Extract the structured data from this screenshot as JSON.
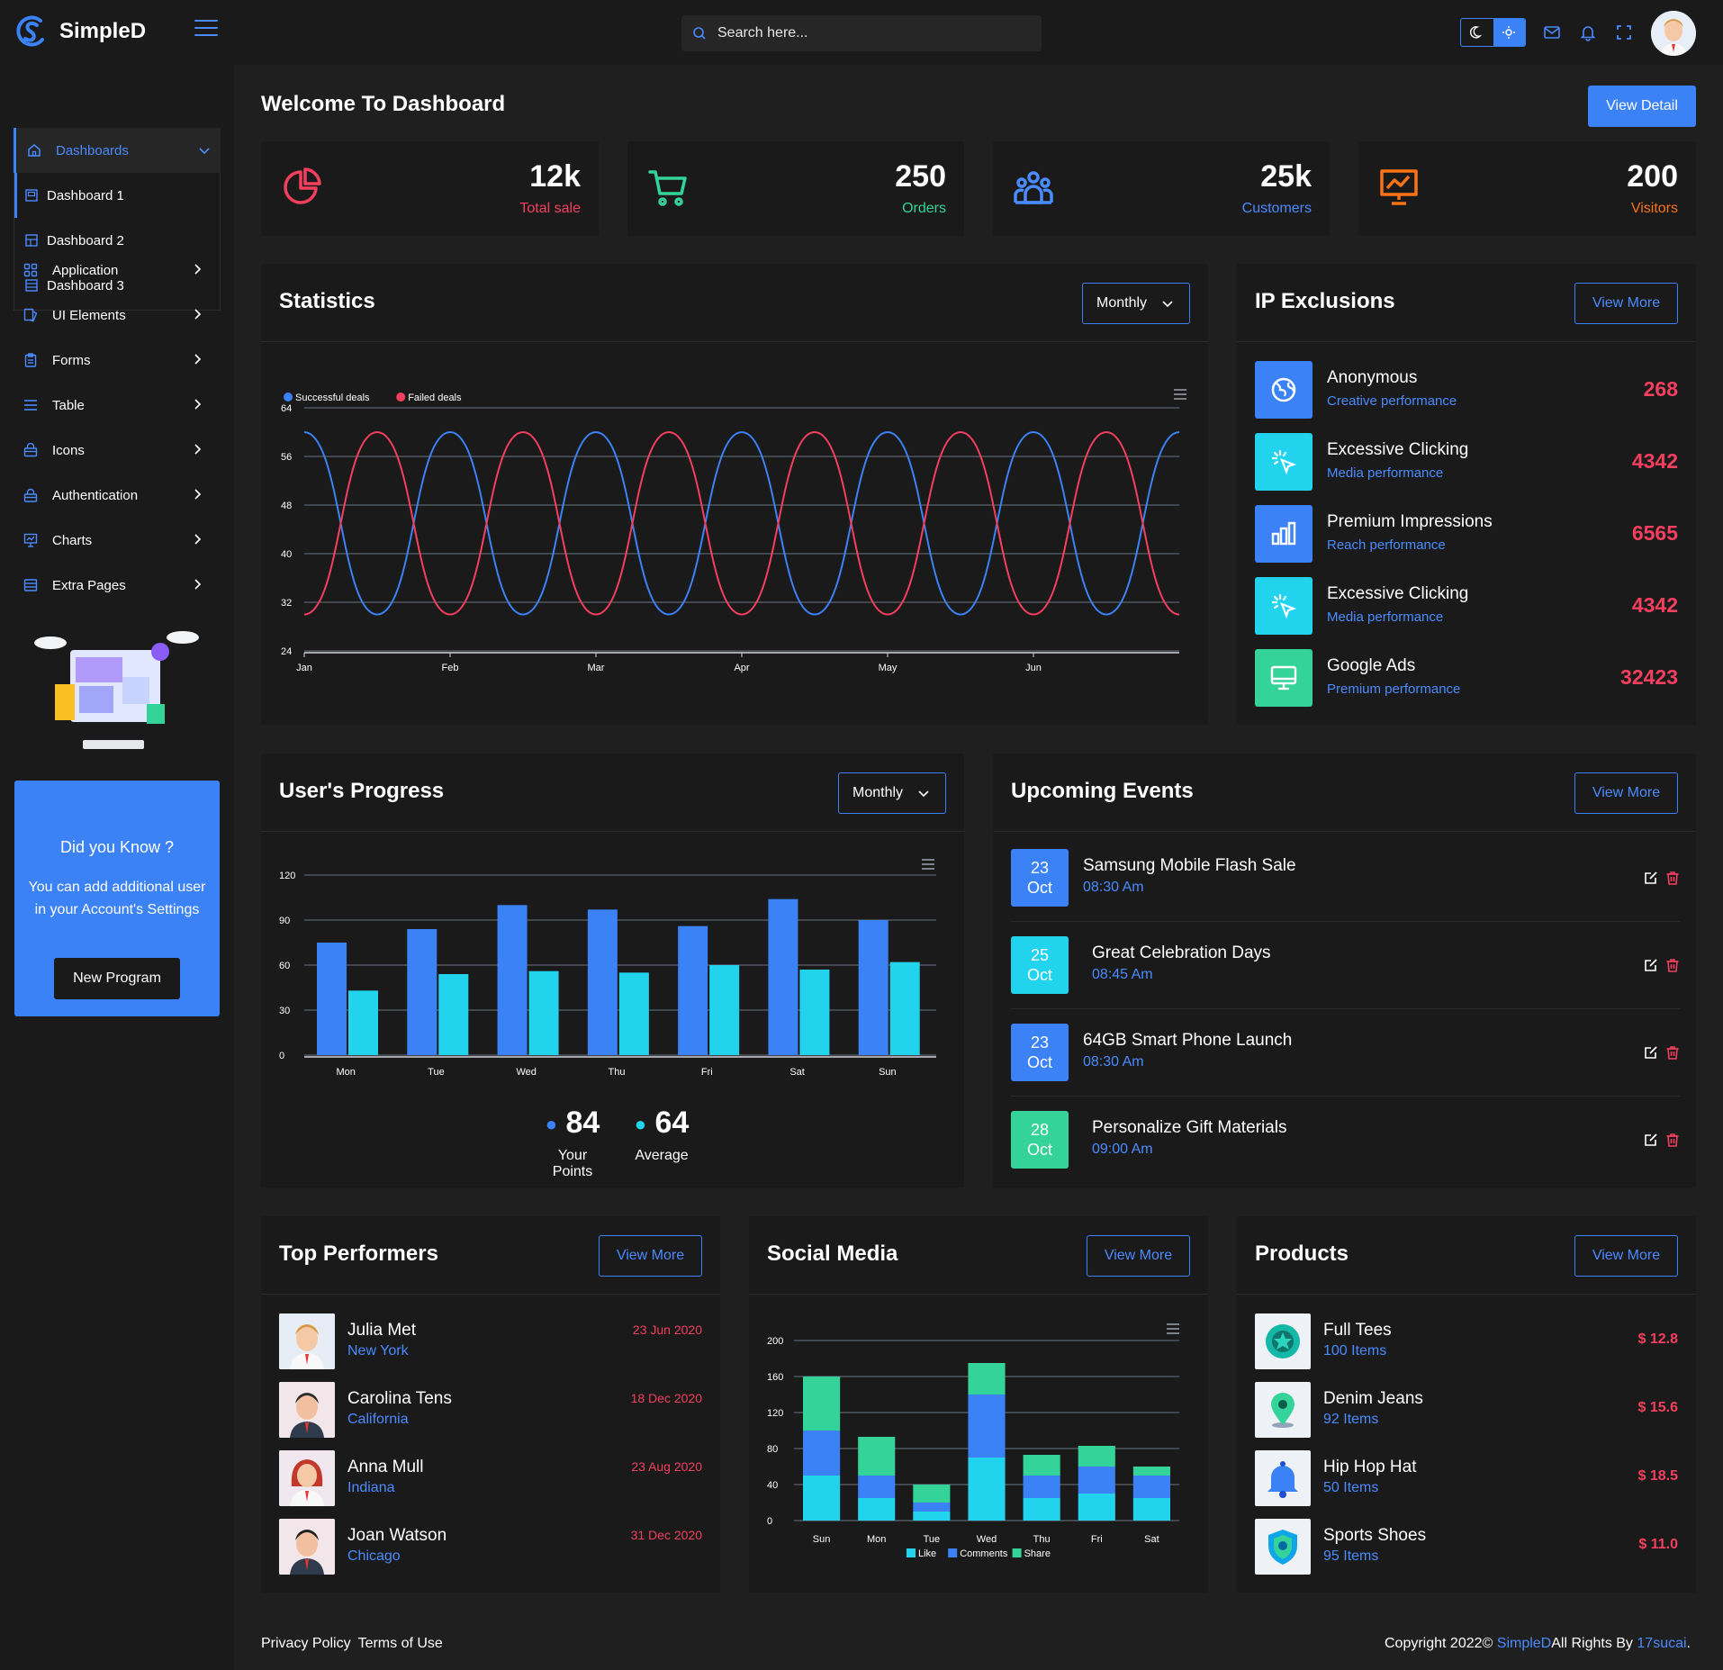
{
  "app": {
    "name": "SimpleD"
  },
  "search": {
    "placeholder": "Search here..."
  },
  "sidebar": {
    "active_label": "Dashboards",
    "submenu": [
      "Dashboard 1",
      "Dashboard 2",
      "Dashboard 3"
    ],
    "items": [
      {
        "label": "Application",
        "icon": "grid-icon"
      },
      {
        "label": "UI Elements",
        "icon": "layers-icon"
      },
      {
        "label": "Forms",
        "icon": "clipboard-icon"
      },
      {
        "label": "Table",
        "icon": "list-icon"
      },
      {
        "label": "Icons",
        "icon": "bag-icon"
      },
      {
        "label": "Authentication",
        "icon": "lock-icon"
      },
      {
        "label": "Charts",
        "icon": "presentation-icon"
      },
      {
        "label": "Extra Pages",
        "icon": "layout-icon"
      }
    ],
    "promo": {
      "title": "Did you Know ?",
      "text": "You can add additional user in your Account's Settings",
      "button": "New Program"
    }
  },
  "page": {
    "title": "Welcome To Dashboard",
    "view_detail": "View Detail"
  },
  "stats": [
    {
      "value": "12k",
      "label": "Total sale",
      "color": "#f43f5e",
      "icon": "pie-chart-icon"
    },
    {
      "value": "250",
      "label": "Orders",
      "color": "#34d399",
      "icon": "cart-icon"
    },
    {
      "value": "25k",
      "label": "Customers",
      "color": "#4a8bff",
      "icon": "users-icon"
    },
    {
      "value": "200",
      "label": "Visitors",
      "color": "#f97316",
      "icon": "presentation-icon"
    }
  ],
  "statistics": {
    "title": "Statistics",
    "filter": "Monthly",
    "chart_data": {
      "type": "line",
      "x": [
        "Jan",
        "Feb",
        "Mar",
        "Apr",
        "May",
        "Jun"
      ],
      "ylim": [
        24,
        64
      ],
      "yticks": [
        24,
        32,
        40,
        48,
        56,
        64
      ],
      "series": [
        {
          "name": "Successful deals",
          "color": "#3b82f6",
          "values": [
            60,
            30,
            60,
            30,
            60,
            30,
            60,
            30,
            60,
            30,
            60,
            30,
            60
          ]
        },
        {
          "name": "Failed deals",
          "color": "#f43f5e",
          "values": [
            30,
            60,
            30,
            60,
            30,
            60,
            30,
            60,
            30,
            60,
            30,
            60,
            30
          ]
        }
      ]
    }
  },
  "ip": {
    "title": "IP Exclusions",
    "view_more": "View More",
    "rows": [
      {
        "name": "Anonymous",
        "sub": "Creative performance",
        "value": "268",
        "color": "#3b82f6",
        "icon": "globe-icon"
      },
      {
        "name": "Excessive Clicking",
        "sub": "Media performance",
        "value": "4342",
        "color": "#22d3ee",
        "icon": "cursor-click-icon"
      },
      {
        "name": "Premium Impressions",
        "sub": "Reach performance",
        "value": "6565",
        "color": "#3b82f6",
        "icon": "bar-chart-icon"
      },
      {
        "name": "Excessive Clicking",
        "sub": "Media performance",
        "value": "4342",
        "color": "#22d3ee",
        "icon": "cursor-click-icon"
      },
      {
        "name": "Google Ads",
        "sub": "Premium performance",
        "value": "32423",
        "color": "#34d399",
        "icon": "monitor-icon"
      }
    ]
  },
  "progress": {
    "title": "User's Progress",
    "filter": "Monthly",
    "chart_data": {
      "type": "bar",
      "categories": [
        "Mon",
        "Tue",
        "Wed",
        "Thu",
        "Fri",
        "Sat",
        "Sun"
      ],
      "ylim": [
        0,
        120
      ],
      "yticks": [
        0,
        30,
        60,
        90,
        120
      ],
      "series": [
        {
          "color": "#3b82f6",
          "values": [
            75,
            84,
            100,
            97,
            86,
            104,
            90
          ]
        },
        {
          "color": "#22d3ee",
          "values": [
            43,
            54,
            56,
            55,
            60,
            57,
            62
          ]
        }
      ]
    },
    "points": "84",
    "points_label": "Your Points",
    "average": "64",
    "average_label": "Average"
  },
  "events": {
    "title": "Upcoming Events",
    "view_more": "View More",
    "rows": [
      {
        "day": "23",
        "month": "Oct",
        "name": "Samsung Mobile Flash Sale",
        "time": "08:30 Am",
        "color": "#3b82f6"
      },
      {
        "day": "25",
        "month": "Oct",
        "name": "Great Celebration Days",
        "time": "08:45 Am",
        "color": "#22d3ee"
      },
      {
        "day": "23",
        "month": "Oct",
        "name": "64GB Smart Phone Launch",
        "time": "08:30 Am",
        "color": "#3b82f6"
      },
      {
        "day": "28",
        "month": "Oct",
        "name": "Personalize Gift Materials",
        "time": "09:00 Am",
        "color": "#34d399"
      }
    ]
  },
  "performers": {
    "title": "Top Performers",
    "view_more": "View More",
    "rows": [
      {
        "name": "Julia Met",
        "location": "New York",
        "date": "23 Jun 2020"
      },
      {
        "name": "Carolina Tens",
        "location": "California",
        "date": "18 Dec 2020"
      },
      {
        "name": "Anna Mull",
        "location": "Indiana",
        "date": "23 Aug 2020"
      },
      {
        "name": "Joan Watson",
        "location": "Chicago",
        "date": "31 Dec 2020"
      }
    ]
  },
  "social": {
    "title": "Social Media",
    "view_more": "View More",
    "chart_data": {
      "type": "bar",
      "stacked": true,
      "categories": [
        "Sun",
        "Mon",
        "Tue",
        "Wed",
        "Thu",
        "Fri",
        "Sat"
      ],
      "ylim": [
        0,
        200
      ],
      "yticks": [
        0,
        40,
        80,
        120,
        160,
        200
      ],
      "series": [
        {
          "name": "Like",
          "color": "#22d3ee",
          "values": [
            50,
            25,
            10,
            70,
            25,
            30,
            25
          ]
        },
        {
          "name": "Comments",
          "color": "#3b82f6",
          "values": [
            50,
            25,
            10,
            70,
            25,
            30,
            25
          ]
        },
        {
          "name": "Share",
          "color": "#34d399",
          "values": [
            60,
            43,
            20,
            35,
            23,
            23,
            10
          ]
        }
      ]
    }
  },
  "products": {
    "title": "Products",
    "view_more": "View More",
    "rows": [
      {
        "name": "Full Tees",
        "qty": "100 Items",
        "price": "$ 12.8",
        "icon": "badge-icon"
      },
      {
        "name": "Denim Jeans",
        "qty": "92 Items",
        "price": "$ 15.6",
        "icon": "map-pin-icon"
      },
      {
        "name": "Hip Hop Hat",
        "qty": "50 Items",
        "price": "$ 18.5",
        "icon": "bell-icon"
      },
      {
        "name": "Sports Shoes",
        "qty": "95 Items",
        "price": "$ 11.0",
        "icon": "shield-icon"
      }
    ]
  },
  "footer": {
    "privacy": "Privacy Policy",
    "terms": "Terms of Use",
    "copyright": "Copyright 2022©",
    "brand": "SimpleD",
    "rights": "All Rights By",
    "author": "17sucai",
    "end": "."
  }
}
